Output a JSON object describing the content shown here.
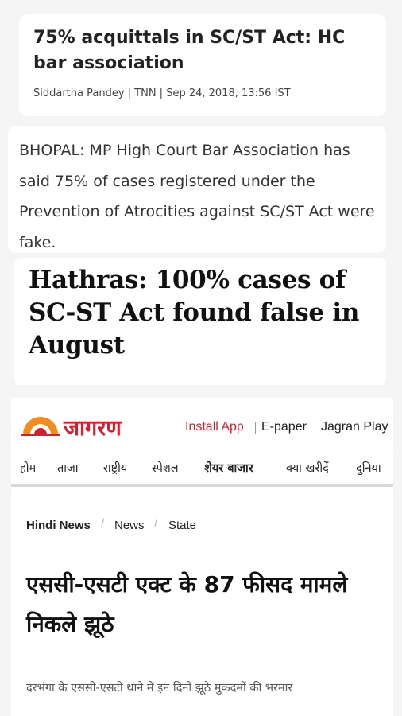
{
  "card1": {
    "title": "75% acquittals in SC/ST Act: HC bar association",
    "byline": "Siddartha Pandey | TNN | Sep 24, 2018, 13:56 IST"
  },
  "card2": {
    "text": "BHOPAL: MP High Court Bar Association has said 75% of cases registered under the Prevention of Atrocities against SC/ST Act were fake."
  },
  "card3": {
    "title": "Hathras: 100% cases of SC-ST Act found false in August"
  },
  "jagran": {
    "logo_text": "जागरण",
    "header_links": {
      "install_app": "Install App",
      "epaper": "E-paper",
      "jagran_play": "Jagran Play"
    },
    "nav": [
      "होम",
      "ताजा",
      "राष्ट्रीय",
      "स्पेशल",
      "शेयर बाजार",
      "क्या खरीदें",
      "दुनिया"
    ],
    "breadcrumb": [
      "Hindi News",
      "News",
      "State"
    ],
    "headline": "एससी-एसटी एक्ट के 87 फीसद मामले निकले झूठे",
    "subheadline": "दरभंगा के एससी-एसटी थाने में इन दिनों झूठे मुकदमों की भरमार"
  },
  "colors": {
    "brand_red": "#d3202f",
    "sun_orange": "#f28c1e"
  }
}
